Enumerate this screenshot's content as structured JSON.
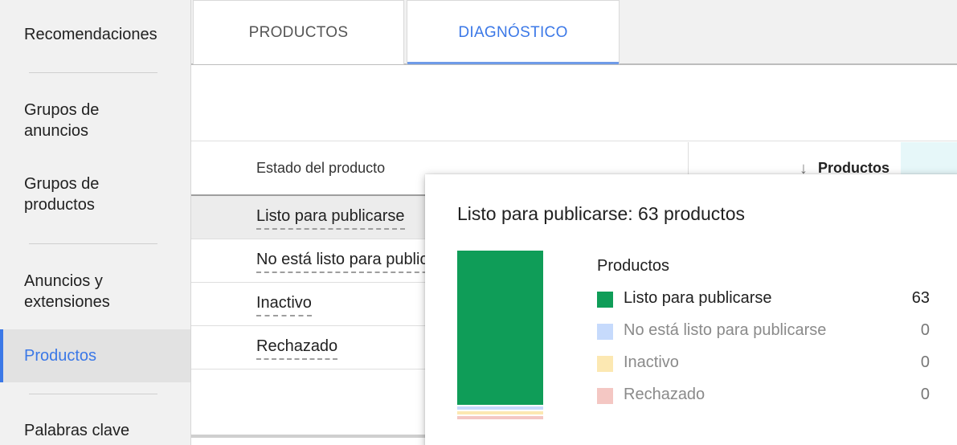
{
  "sidebar": {
    "items": [
      {
        "label": "Recomendaciones"
      },
      {
        "label": "Grupos de anuncios"
      },
      {
        "label": "Grupos de productos"
      },
      {
        "label": "Anuncios y extensiones"
      },
      {
        "label": "Productos"
      },
      {
        "label": "Palabras clave"
      }
    ],
    "active_index": 4
  },
  "tabs": [
    {
      "label": "PRODUCTOS"
    },
    {
      "label": "DIAGNÓSTICO"
    }
  ],
  "table": {
    "headers": {
      "status": "Estado del producto",
      "products": "Productos",
      "sort_icon": "arrow-down-icon"
    },
    "rows": [
      {
        "label": "Listo para publicarse"
      },
      {
        "label": "No está listo para publicarse"
      },
      {
        "label": "Inactivo"
      },
      {
        "label": "Rechazado"
      }
    ]
  },
  "popup": {
    "title": "Listo para publicarse: 63 productos",
    "legend_title": "Productos"
  },
  "colors": {
    "accent": "#3b78e7",
    "green": "#0f9d58",
    "blue_light": "#c6dafc",
    "yellow_light": "#fce8b2",
    "red_light": "#f4c7c3"
  },
  "chart_data": {
    "type": "bar",
    "categories": [
      "Listo para publicarse",
      "No está listo para publicarse",
      "Inactivo",
      "Rechazado"
    ],
    "values": [
      63,
      0,
      0,
      0
    ],
    "colors": [
      "#0f9d58",
      "#c6dafc",
      "#fce8b2",
      "#f4c7c3"
    ],
    "title": "Listo para publicarse: 63 productos",
    "legend_title": "Productos",
    "stacked": true
  }
}
